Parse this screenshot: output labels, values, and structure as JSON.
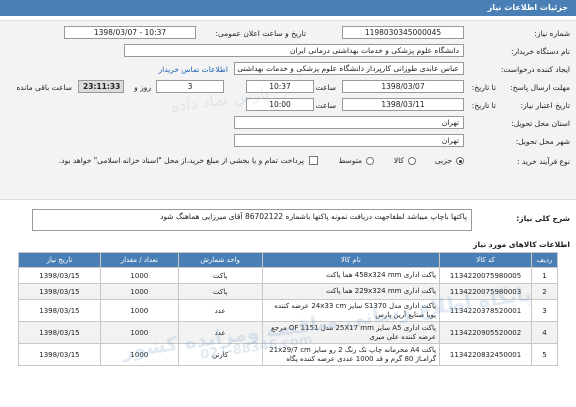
{
  "page_title": "جزئیات اطلاعات نیاز",
  "fields": {
    "need_number_label": "شماره نیاز:",
    "need_number": "1198030345000045",
    "announce_label": "تاریخ و ساعت اعلان عمومی:",
    "announce_value": "1398/03/07 - 10:37",
    "buyer_org_label": "نام دستگاه خریدار:",
    "buyer_org": "دانشگاه علوم پزشکی و خدمات بهداشتی درمانی ایران",
    "creator_label": "ایجاد کننده درخواست:",
    "creator": "عباس عابدی طوزانی کارپرداز دانشگاه علوم پزشکی و خدمات بهداشتی درمانی ایران",
    "contact_link": "اطلاعات تماس خریدار",
    "reply_deadline_label": "مهلت ارسال پاسخ:",
    "reply_deadline_prefix": "تا تاریخ:",
    "reply_date": "1398/03/07",
    "time_label": "ساعت",
    "reply_time": "10:37",
    "days_value": "3",
    "days_label": "روز و",
    "remaining_time": "23:11:33",
    "remaining_label": "ساعت باقی مانده",
    "validity_label": "تاریخ اعتبار نیاز:",
    "validity_prefix": "تا تاریخ:",
    "validity_date": "1398/03/11",
    "validity_time": "10:00",
    "province_label": "استان محل تحویل:",
    "province": "تهران",
    "city_label": "شهر محل تحویل:",
    "city": "تهران",
    "purchase_type_label": "نوع فرآیند خرید :",
    "opt_partial": "جزیی",
    "opt_medium": "متوسط",
    "opt_medium_label": "متوسط",
    "payment_note": "پرداخت تمام و یا بخشی از مبلغ خرید،از محل \"اسناد خزانه اسلامی\" خواهد بود."
  },
  "purchase_options": [
    "جزیی",
    "کالا",
    "متوسط"
  ],
  "description_label": "شرح کلی نیاز:",
  "description": "پاکتها باچاپ میباشد لطفاجهت دریافت نمونه پاکتها باشماره 86702122 آقای میرزایی هماهنگ شود",
  "items_title": "اطلاعات کالاهای مورد نیاز",
  "table": {
    "headers": [
      "ردیف",
      "کد کالا",
      "نام کالا",
      "واحد شمارش",
      "تعداد / مقدار",
      "تاریخ نیاز"
    ],
    "rows": [
      {
        "idx": "1",
        "code": "1134220075980005",
        "name": "پاکت اداری 458x324 mm هما پاکت",
        "unit": "پاکت",
        "qty": "1000",
        "date": "1398/03/15"
      },
      {
        "idx": "2",
        "code": "1134220075980003",
        "name": "پاکت اداری 229x324 mm هما پاکت",
        "unit": "پاکت",
        "qty": "1000",
        "date": "1398/03/15"
      },
      {
        "idx": "3",
        "code": "1134220378520001",
        "name": "پاکت اداری مدل S1370 سایز 24x33 cm عرضه کننده پویا صنایع آرین پارس",
        "unit": "عدد",
        "qty": "1000",
        "date": "1398/03/15"
      },
      {
        "idx": "4",
        "code": "1134220905520002",
        "name": "پاکت اداری A5 سایز 25X17 mm مدل OF 1151 مرجع عرضه کننده علی میری",
        "unit": "عدد",
        "qty": "1000",
        "date": "1398/03/15"
      },
      {
        "idx": "5",
        "code": "1134220832450001",
        "name": "پاکت A4 محرمانه چاپ تک رنگ 2 رو سایز 21x29/7 cm گرامـاژ 80 گرم و قد 1000 عددی عرضه کننده پگاه",
        "unit": "کارتن",
        "qty": "1000",
        "date": "1398/03/15"
      }
    ]
  },
  "watermark": {
    "line1": "پایگاه اطلاع رسانی مناقصه ومزایده کشور",
    "line2": "021-88346.com",
    "top": "پارس نماد داده"
  }
}
